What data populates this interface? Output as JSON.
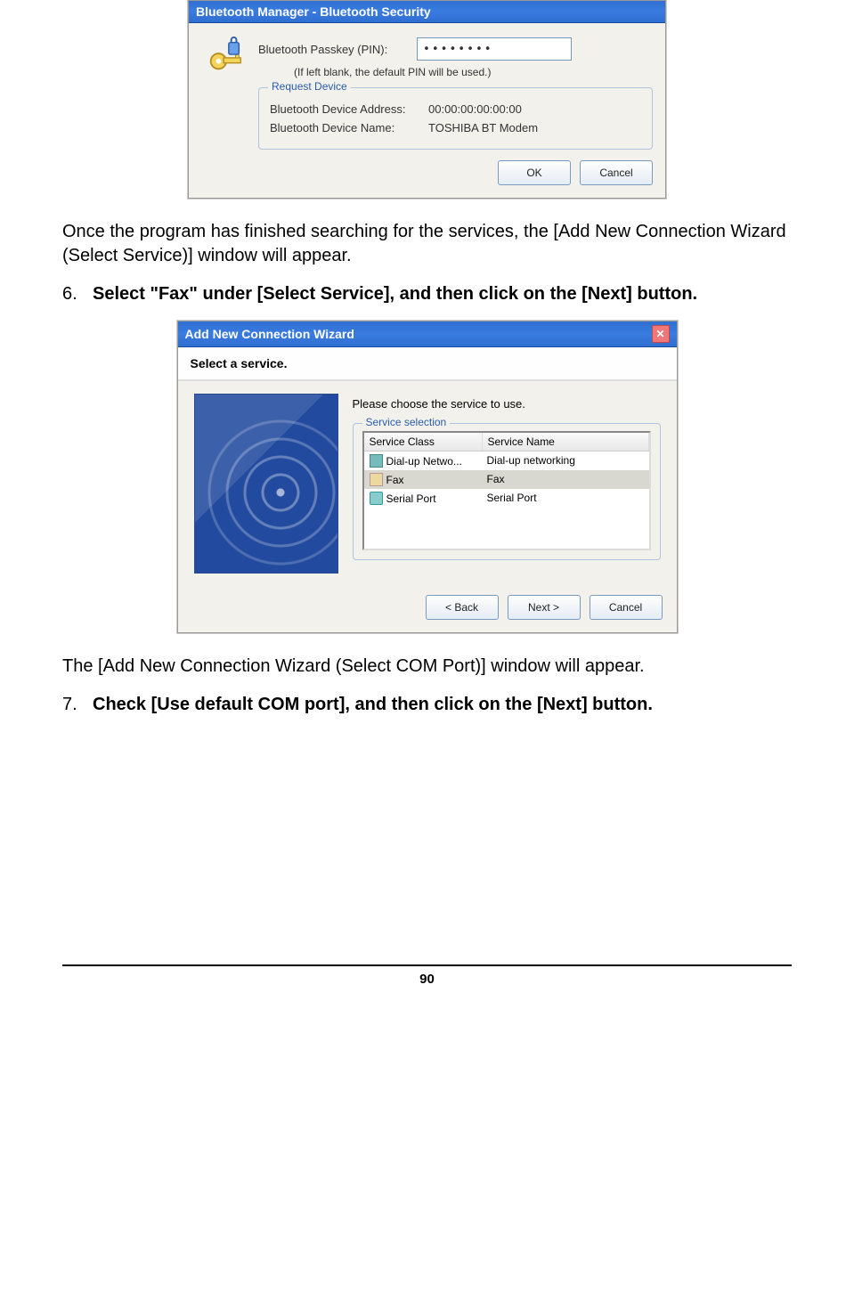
{
  "dialog1": {
    "title": "Bluetooth Manager - Bluetooth Security",
    "passkey_label": "Bluetooth Passkey (PIN):",
    "passkey_value": "••••••••",
    "hint": "(If left blank, the default PIN will be used.)",
    "group_title": "Request Device",
    "addr_label": "Bluetooth Device Address:",
    "addr_value": "00:00:00:00:00:00",
    "name_label": "Bluetooth Device Name:",
    "name_value": "TOSHIBA BT Modem",
    "ok": "OK",
    "cancel": "Cancel"
  },
  "para1": "Once the program has finished searching for the services, the [Add New Connection Wizard (Select Service)] window will appear.",
  "step6_num": "6.",
  "step6_text": "Select \"Fax\" under [Select Service], and then click on the [Next] button.",
  "dialog2": {
    "title": "Add New Connection Wizard",
    "subtitle": "Select a service.",
    "prompt": "Please choose the service to use.",
    "group_title": "Service selection",
    "col1": "Service Class",
    "col2": "Service Name",
    "rows": [
      {
        "c1": "Dial-up Netwo...",
        "c2": "Dial-up networking",
        "sel": false,
        "icon": "modem-icon"
      },
      {
        "c1": "Fax",
        "c2": "Fax",
        "sel": true,
        "icon": "fax-icon"
      },
      {
        "c1": "Serial Port",
        "c2": "Serial Port",
        "sel": false,
        "icon": "serial-port-icon"
      }
    ],
    "back": "< Back",
    "next": "Next >",
    "cancel": "Cancel"
  },
  "para2": "The [Add New Connection Wizard (Select COM Port)] window will appear.",
  "step7_num": "7.",
  "step7_text": "Check [Use default COM port], and then click on the [Next] button.",
  "page_number": "90"
}
